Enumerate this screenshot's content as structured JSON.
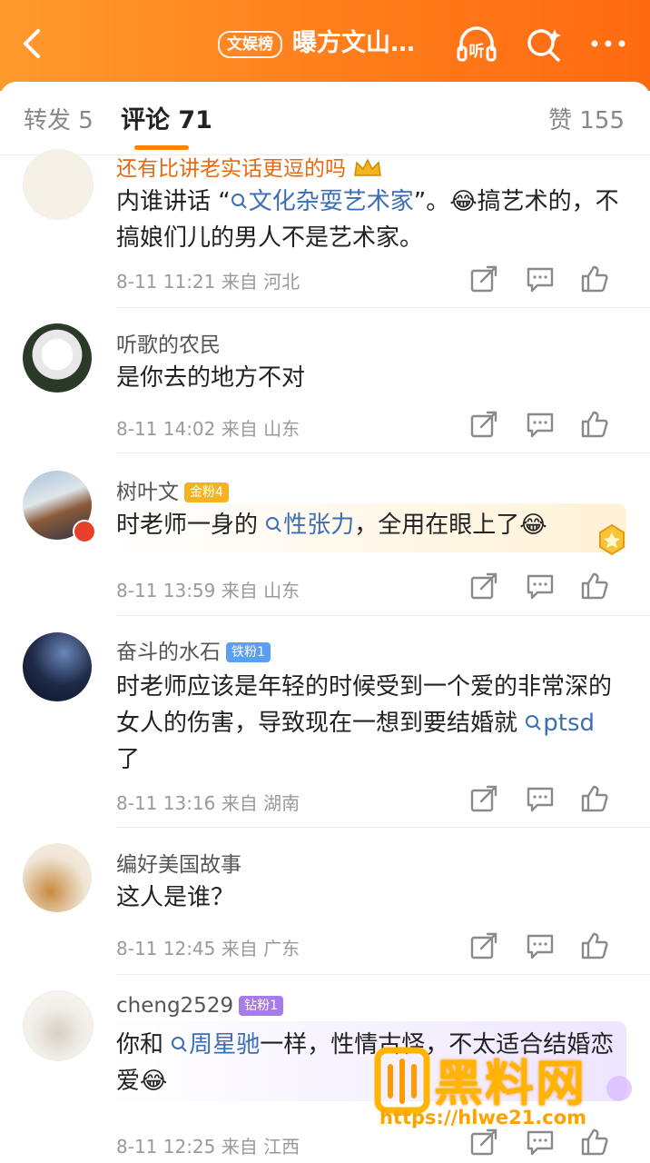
{
  "header": {
    "back_icon": "chevron-left-icon",
    "tag": "文娱榜",
    "title": "曝方文山…",
    "listen_label": "听",
    "search_icon": "search-sparkle-icon",
    "more_icon": "more-dots-icon",
    "accent": "#ff7a1a"
  },
  "tabs": {
    "repost": "转发 5",
    "comments": "评论 71",
    "likes": "赞 155"
  },
  "comments": [
    {
      "user": "还有比讲老实话更逗的吗",
      "crown_icon": "crown-icon",
      "text_parts": [
        "内谁讲话 “",
        "文化杂耍艺术家",
        "”。",
        "😂",
        "搞艺术的，不搞娘们儿的男人不是艺术家。"
      ],
      "time": "8-11 11:21",
      "from": "来自",
      "location": "河北"
    },
    {
      "user": "听歌的农民",
      "text": "是你去的地方不对",
      "time": "8-11 14:02",
      "from": "来自",
      "location": "山东"
    },
    {
      "user": "树叶文",
      "badge": "金粉4",
      "text_parts": [
        "时老师一身的 ",
        "性张力",
        "，全用在眼上了",
        "😂"
      ],
      "time": "8-11 13:59",
      "from": "来自",
      "location": "山东"
    },
    {
      "user": "奋斗的水石",
      "badge": "铁粉1",
      "text_parts": [
        "时老师应该是年轻的时候受到一个爱的非常深的女人的伤害，导致现在一想到要结婚就 ",
        "ptsd",
        " 了"
      ],
      "time": "8-11 13:16",
      "from": "来自",
      "location": "湖南"
    },
    {
      "user": "编好美国故事",
      "text": "这人是谁？",
      "time": "8-11 12:45",
      "from": "来自",
      "location": "广东"
    },
    {
      "user": "cheng2529",
      "badge": "钻粉1",
      "text_parts": [
        "你和 ",
        "周星驰",
        "一样，性情古怪，不太适合结婚恋爱",
        "😂"
      ],
      "time": "8-11 12:25",
      "from": "来自",
      "location": "江西"
    }
  ],
  "watermark": {
    "brand": "黑料网",
    "url": "https://hlwe21.com"
  },
  "colors": {
    "topic": "#3b6fb5",
    "gold_badge": "#f5b324",
    "iron_badge": "#5aa0f0",
    "diamond_badge": "#a77be8"
  }
}
